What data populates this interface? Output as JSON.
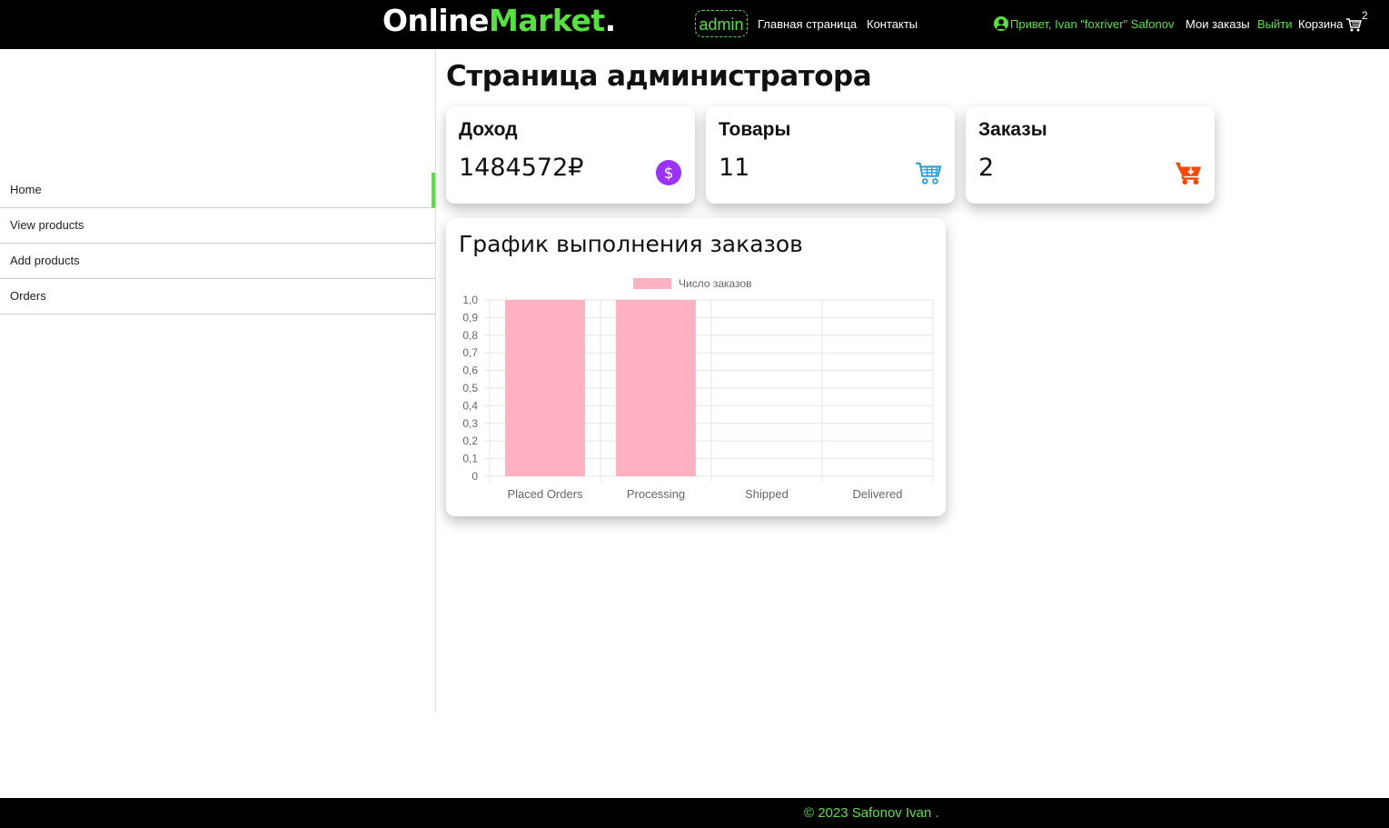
{
  "header": {
    "logo_main": "Online",
    "logo_accent": "Market",
    "logo_dot": ".",
    "admin_badge": "admin",
    "nav_home": "Главная страница",
    "nav_contacts": "Контакты",
    "greeting": "Привет, Ivan \"foxriver\" Safonov",
    "my_orders": "Мои заказы",
    "logout": "Выйти",
    "cart": "Корзина",
    "cart_count": "2",
    "accent_color": "#55e23e"
  },
  "sidebar": {
    "items": [
      {
        "label": "Home",
        "active": true
      },
      {
        "label": "View products"
      },
      {
        "label": "Add products"
      },
      {
        "label": "Orders"
      }
    ]
  },
  "page": {
    "title": "Страница администратора"
  },
  "cards": [
    {
      "title": "Доход",
      "value": "1484572₽",
      "icon": "dollar-icon",
      "color": "#9b30ff"
    },
    {
      "title": "Товары",
      "value": "11",
      "icon": "cart-icon",
      "color": "#2a9fd8"
    },
    {
      "title": "Заказы",
      "value": "2",
      "icon": "cart-plus-icon",
      "color": "#ff4500"
    }
  ],
  "chart": {
    "title": "График выполнения заказов"
  },
  "chart_data": {
    "type": "bar",
    "categories": [
      "Placed Orders",
      "Processing",
      "Shipped",
      "Delivered"
    ],
    "series": [
      {
        "name": "Число заказов",
        "values": [
          1,
          1,
          0,
          0
        ]
      }
    ],
    "ylim": [
      0,
      1
    ],
    "yticks": [
      "0",
      "0,1",
      "0,2",
      "0,3",
      "0,4",
      "0,5",
      "0,6",
      "0,7",
      "0,8",
      "0,9",
      "1,0"
    ],
    "legend": "top",
    "grid": true,
    "bar_color": "#ffb1c1"
  },
  "footer": {
    "text": "© 2023 Safonov Ivan ."
  }
}
